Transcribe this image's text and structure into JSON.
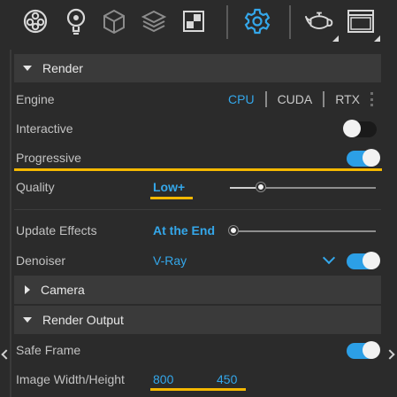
{
  "toolbar": {
    "icons": [
      "material-ball-icon",
      "light-bulb-icon",
      "geometry-cube-icon",
      "layers-icon",
      "checker-texture-icon",
      "settings-gear-icon",
      "teapot-render-icon",
      "frame-buffer-window-icon"
    ],
    "accent_color": "#34a7ea"
  },
  "render": {
    "header": "Render",
    "engine": {
      "label": "Engine",
      "options": [
        "CPU",
        "CUDA",
        "RTX"
      ],
      "selected": "CPU"
    },
    "interactive": {
      "label": "Interactive",
      "value": false
    },
    "progressive": {
      "label": "Progressive",
      "value": true
    },
    "quality": {
      "label": "Quality",
      "value": "Low+",
      "level": 0.2
    },
    "update_effects": {
      "label": "Update Effects",
      "value": "At the End",
      "level": 0.0
    },
    "denoiser": {
      "label": "Denoiser",
      "value": "V-Ray",
      "enabled": true
    }
  },
  "camera": {
    "header": "Camera"
  },
  "render_output": {
    "header": "Render Output",
    "safe_frame": {
      "label": "Safe Frame",
      "value": true
    },
    "image_size": {
      "label": "Image Width/Height",
      "width": "800",
      "height": "450"
    }
  },
  "highlight_color": "#f5b800"
}
